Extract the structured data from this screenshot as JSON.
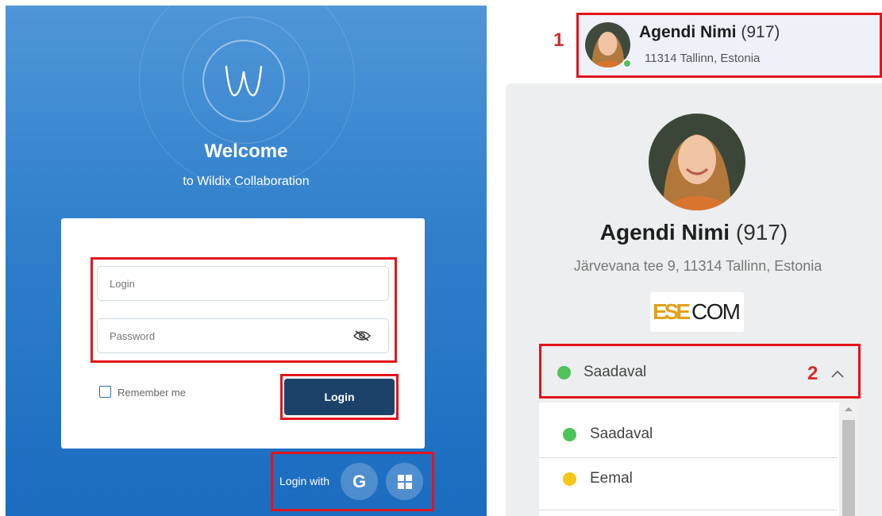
{
  "login": {
    "welcome": "Welcome",
    "subtitle": "to Wildix Collaboration",
    "logo_letter": "W",
    "login_placeholder": "Login",
    "password_placeholder": "Password",
    "remember_label": "Remember me",
    "login_button": "Login",
    "login_with": "Login with",
    "google_letter": "G",
    "icons": [
      "eye-icon",
      "google-icon",
      "windows-icon"
    ]
  },
  "annotations": {
    "marker_1": "1",
    "marker_2": "2",
    "highlight_color": "#e3141b",
    "marker_color": "#d42b2b"
  },
  "profile": {
    "name": "Agendi Nimi",
    "extension": "(917)",
    "mini_address": "11314 Tallinn, Estonia",
    "full_address": "Järvevana tee 9, 11314 Tallinn, Estonia",
    "company_logo": "ESECOM",
    "status": "Saadaval",
    "status_color": "#4fc25a"
  },
  "status_options": [
    {
      "label": "Saadaval",
      "color": "#4fc25a"
    },
    {
      "label": "Eemal",
      "color": "#f5c518"
    }
  ]
}
